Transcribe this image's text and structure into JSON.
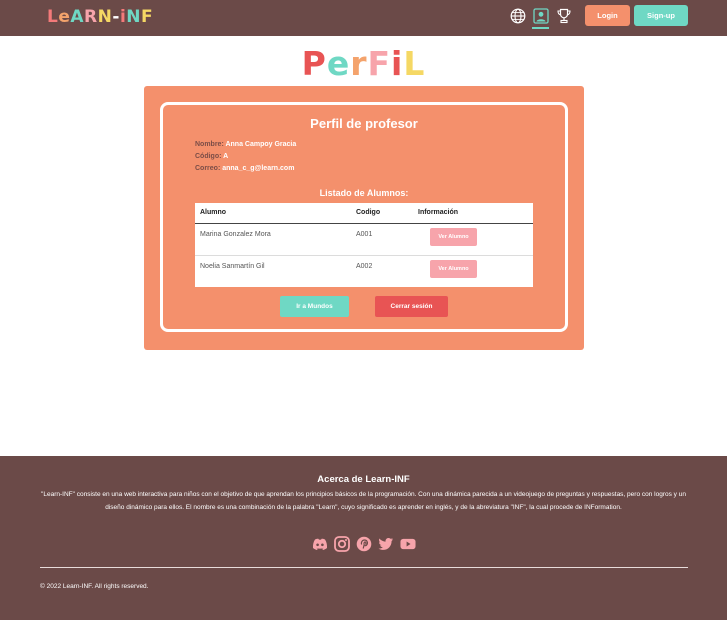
{
  "header": {
    "logo_letters": [
      {
        "char": "L",
        "color": "#f47a7a"
      },
      {
        "char": "e",
        "color": "#f4a36c"
      },
      {
        "char": "A",
        "color": "#6fd8c4"
      },
      {
        "char": "R",
        "color": "#f7a4ab"
      },
      {
        "char": "N",
        "color": "#f5d864"
      },
      {
        "char": "-",
        "color": "#ffffff"
      },
      {
        "char": "i",
        "color": "#f47a7a"
      },
      {
        "char": "N",
        "color": "#6fd8c4"
      },
      {
        "char": "F",
        "color": "#f5d864"
      }
    ],
    "icons": [
      "globe-icon",
      "profile-icon",
      "trophy-icon"
    ],
    "login_label": "Login",
    "signup_label": "Sign-up"
  },
  "title_letters": [
    {
      "char": "P",
      "color": "#e85454"
    },
    {
      "char": "e",
      "color": "#6fd8c4"
    },
    {
      "char": "r",
      "color": "#f4a36c"
    },
    {
      "char": "F",
      "color": "#f7a4ab"
    },
    {
      "char": "i",
      "color": "#e85454"
    },
    {
      "char": "L",
      "color": "#f5d864"
    }
  ],
  "profile": {
    "heading": "Perfil de profesor",
    "name_label": "Nombre:",
    "name_value": "Anna Campoy Gracia",
    "code_label": "Código:",
    "code_value": "A",
    "email_label": "Correo:",
    "email_value": "anna_c_g@learn.com",
    "list_title": "Listado de Alumnos:"
  },
  "table": {
    "headers": [
      "Alumno",
      "Codigo",
      "Información"
    ],
    "rows": [
      {
        "alumno": "Marina Gonzalez Mora",
        "codigo": "A001",
        "button": "Ver Alumno"
      },
      {
        "alumno": "Noelia Sanmartín Gil",
        "codigo": "A002",
        "button": "Ver Alumno"
      }
    ]
  },
  "actions": {
    "mundos_label": "Ir a Mundos",
    "logout_label": "Cerrar sesión"
  },
  "footer": {
    "title": "Acerca de Learn-INF",
    "text": "\"Learn-INF\" consiste en una web interactiva para niños con el objetivo de que aprendan los principios básicos de la programación. Con una dinámica parecida a un videojuego de preguntas y respuestas, pero con logros y un diseño dinámico para ellos. El nombre es una combinación de la palabra \"Learn\", cuyo significado es aprender en inglés, y de la abreviatura \"INF\", la cual procede de INFormation.",
    "social_icons": [
      "discord-icon",
      "instagram-icon",
      "pinterest-icon",
      "twitter-icon",
      "youtube-icon"
    ],
    "copyright": "© 2022 Learn-INF. All rights reserved."
  },
  "colors": {
    "header_bg": "#6b4a48",
    "card_bg": "#f4906c",
    "accent_teal": "#6fd8c4",
    "accent_red": "#e85454",
    "accent_pink": "#f7a4ab"
  }
}
